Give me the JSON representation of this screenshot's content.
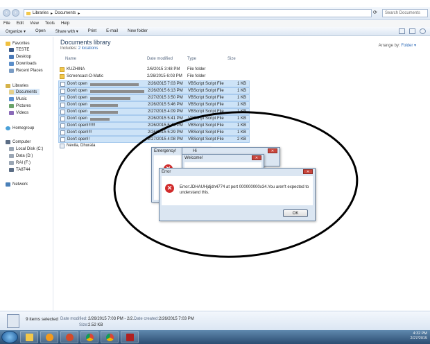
{
  "address": {
    "path": [
      "Libraries",
      "Documents"
    ],
    "search_placeholder": "Search Documents"
  },
  "menu": [
    "File",
    "Edit",
    "View",
    "Tools",
    "Help"
  ],
  "toolbar": {
    "organize": "Organize ▾",
    "open": "Open",
    "share": "Share with ▾",
    "print": "Print",
    "email": "E-mail",
    "newfolder": "New folder"
  },
  "nav": {
    "favorites": "Favorites",
    "teste": "TESTE",
    "desktop": "Desktop",
    "downloads": "Downloads",
    "recent": "Recent Places",
    "libraries": "Libraries",
    "documents": "Documents",
    "music": "Music",
    "pictures": "Pictures",
    "videos": "Videos",
    "homegroup": "Homegroup",
    "computer": "Computer",
    "local": "Local Disk (C:)",
    "data": "Data (D:)",
    "rai": "RAI (F:)",
    "ta": "TA8744",
    "network": "Network"
  },
  "library": {
    "title": "Documents library",
    "includes_label": "Includes:",
    "locations": "2 locations",
    "arrange_label": "Arrange by:",
    "arrange_value": "Folder ▾"
  },
  "columns": {
    "name": "Name",
    "date": "Date modified",
    "type": "Type",
    "size": "Size"
  },
  "files": [
    {
      "name": "KUZHINA",
      "date": "2/6/2015 3:48 PM",
      "type": "File folder",
      "size": "",
      "icon": "folder",
      "selected": false
    },
    {
      "name": "Screencast-O-Matic",
      "date": "2/26/2015 6:03 PM",
      "type": "File folder",
      "size": "",
      "icon": "folder",
      "selected": false
    },
    {
      "name": "Don't open",
      "date": "2/26/2015 7:03 PM",
      "type": "VBScript Script File",
      "size": "1 KB",
      "icon": "vbs",
      "selected": true
    },
    {
      "name": "Don't open",
      "date": "2/26/2015 6:13 PM",
      "type": "VBScript Script File",
      "size": "1 KB",
      "icon": "vbs",
      "selected": true
    },
    {
      "name": "Don't open",
      "date": "2/27/2015 3:50 PM",
      "type": "VBScript Script File",
      "size": "1 KB",
      "icon": "vbs",
      "selected": true
    },
    {
      "name": "Don't open",
      "date": "2/26/2015 5:46 PM",
      "type": "VBScript Script File",
      "size": "1 KB",
      "icon": "vbs",
      "selected": true
    },
    {
      "name": "Don't open",
      "date": "2/27/2015 4:09 PM",
      "type": "VBScript Script File",
      "size": "1 KB",
      "icon": "vbs",
      "selected": true
    },
    {
      "name": "Don't open",
      "date": "2/26/2015 5:41 PM",
      "type": "VBScript Script File",
      "size": "1 KB",
      "icon": "vbs",
      "selected": true
    },
    {
      "name": "Don't open!!!!!!!",
      "date": "2/26/2015 5:45 PM",
      "type": "VBScript Script File",
      "size": "1 KB",
      "icon": "vbs",
      "selected": true
    },
    {
      "name": "Don't open!!!!",
      "date": "2/26/2015 5:29 PM",
      "type": "VBScript Script File",
      "size": "1 KB",
      "icon": "vbs",
      "selected": true
    },
    {
      "name": "Don't open!!",
      "date": "2/27/2015 4:08 PM",
      "type": "VBScript Script File",
      "size": "2 KB",
      "icon": "vbs",
      "selected": true
    },
    {
      "name": "Nevila, Dhurata",
      "date": "",
      "type": "",
      "size": "",
      "icon": "contact",
      "selected": false
    }
  ],
  "details": {
    "count": "9 items selected",
    "modified_label": "Date modified:",
    "modified": "2/26/2015 7:03 PM - 2/2...",
    "created_label": "Date created:",
    "created": "2/26/2015 7:03 PM",
    "size_label": "Size:",
    "size": "2.52 KB"
  },
  "dialogs": {
    "emergency_title": "Emergency!",
    "hi_title": "Hi",
    "welcome_title": "Welcome!",
    "error_title": "Error",
    "error_message": "Error:JDHAUHjdjdn4774 at port 000000000x34.You aren't expected to understand this.",
    "ok": "OK"
  },
  "tray": {
    "time": "4:32 PM",
    "date": "2/27/2015"
  },
  "colors": {
    "selection": "#cde3f7",
    "accent": "#2e6bb8",
    "error": "#d12c2c"
  }
}
